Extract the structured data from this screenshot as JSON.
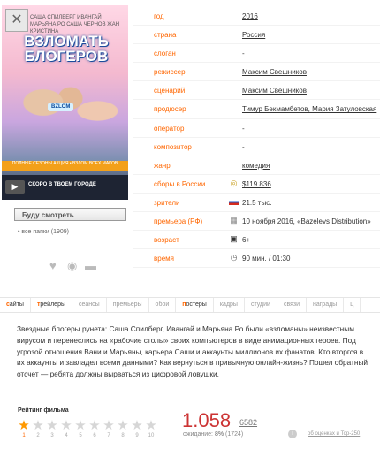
{
  "poster": {
    "title_line1": "ВЗЛОМАТЬ",
    "title_line2": "БЛОГЕРОВ",
    "cast": "САША СПИЛБЕРГ  ИВАНГАЙ  МАРЬЯНА РО  САША ЧЕРНОВ  ЖАН КРИСТИНА",
    "sign": "BZLOM",
    "strip": "ПОЛНЫЕ СЕЗОНЫ АКЦИЯ • ВЗЛОМ ВСЕХ МАКОВ",
    "release": "СКОРО В ТВОЕМ ГОРОДЕ",
    "play_icon": "play-icon"
  },
  "want_button": "Буду смотреть",
  "folders": {
    "text": "все папки (1909)"
  },
  "info": [
    {
      "label": "год",
      "value": "2016",
      "link": true
    },
    {
      "label": "страна",
      "value": "Россия",
      "link": true
    },
    {
      "label": "слоган",
      "value": "-",
      "link": false
    },
    {
      "label": "режиссер",
      "value": "Максим Свешников",
      "link": true
    },
    {
      "label": "сценарий",
      "value": "Максим Свешников",
      "link": true
    },
    {
      "label": "продюсер",
      "value": "Тимур Бекмамбетов, Мария Затуловская",
      "link": true
    },
    {
      "label": "оператор",
      "value": "-",
      "link": false
    },
    {
      "label": "композитор",
      "value": "-",
      "link": false
    },
    {
      "label": "жанр",
      "value": "комедия",
      "link": true
    },
    {
      "label": "сборы в России",
      "value": "$119 836",
      "link": true,
      "icon": "coins-icon"
    },
    {
      "label": "зрители",
      "value": "21.5 тыс.",
      "link": false,
      "icon": "russia-flag-icon"
    },
    {
      "label": "премьера (РФ)",
      "value": "10 ноября 2016",
      "extra": ", «Bazelevs Distribution»",
      "link": true,
      "icon": "calendar-icon"
    },
    {
      "label": "возраст",
      "value": "6+",
      "link": false,
      "icon": "age-icon"
    },
    {
      "label": "время",
      "value": "90 мин. / 01:30",
      "link": false,
      "icon": "clock-icon"
    }
  ],
  "tabs": [
    {
      "label": "сайты",
      "accent": "с"
    },
    {
      "label": "трейлеры",
      "accent": "т"
    },
    {
      "label": "сеансы"
    },
    {
      "label": "премьеры"
    },
    {
      "label": "обои"
    },
    {
      "label": "постеры",
      "accent": "п"
    },
    {
      "label": "кадры"
    },
    {
      "label": "студии"
    },
    {
      "label": "связи"
    },
    {
      "label": "награды"
    },
    {
      "label": "ц"
    }
  ],
  "description": "Звездные блогеры рунета: Саша Спилберг, Ивангай и Марьяна Ро были «взломаны» неизвестным вирусом и перенеслись на «рабочие столы» своих компьютеров в виде анимационных героев. Под угрозой отношения Вани и Марьяны, карьера Саши и аккаунты миллионов их фанатов. Кто вторгся в их аккаунты и завладел всеми данными? Как вернуться в привычную онлайн-жизнь? Пошел обратный отсчет — ребята должны вырваться из цифровой ловушки.",
  "rating": {
    "title": "Рейтинг фильма",
    "value": "1.058",
    "votes": "6582",
    "await_label": "ожидание:",
    "await_percent": "8%",
    "await_count": "(1724)",
    "stars_filled": 1,
    "star_numbers": [
      "1",
      "2",
      "3",
      "4",
      "5",
      "6",
      "7",
      "8",
      "9",
      "10"
    ],
    "top250": "об оценках и Top-250"
  },
  "colors": {
    "accent": "#ff6600",
    "rating": "#cc3333"
  }
}
